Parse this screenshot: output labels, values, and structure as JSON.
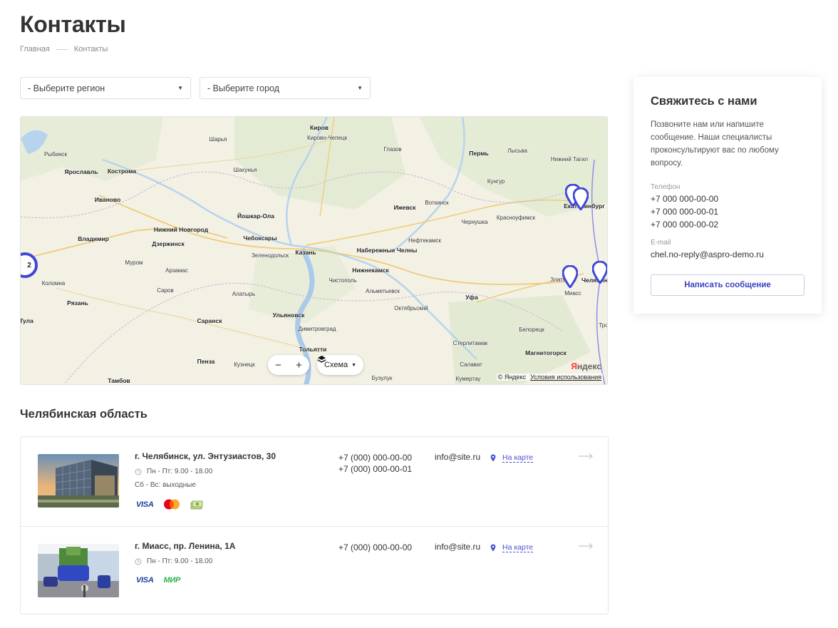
{
  "page": {
    "title": "Контакты"
  },
  "breadcrumb": {
    "home": "Главная",
    "current": "Контакты"
  },
  "filters": {
    "region_label": "- Выберите регион",
    "city_label": "- Выберите город"
  },
  "map": {
    "cities": [
      "Рыбинск",
      "Ярославль",
      "Кострома",
      "Шарья",
      "Киров",
      "Кирово-Чепецк",
      "Глазов",
      "Пермь",
      "Лысьва",
      "Нижний Тагил",
      "Шахунья",
      "Иваново",
      "Кунгур",
      "Екатеринбург",
      "Йошкар-Ола",
      "Ижевск",
      "Воткинск",
      "Красноуфимск",
      "Нижний Новгород",
      "Чебоксары",
      "Чернушка",
      "Владимир",
      "Дзержинск",
      "Нефтекамск",
      "Набережные Челны",
      "Зеленодольск",
      "Казань",
      "Муром",
      "Арзамас",
      "Нижнекамск",
      "Коломна",
      "Саров",
      "Чистополь",
      "Альметьевск",
      "Уфа",
      "Златоуст",
      "Миасс",
      "Челябинск",
      "Рязань",
      "Алатырь",
      "Октябрьский",
      "Ульяновск",
      "Тула",
      "Саранск",
      "Димитровград",
      "Белорецк",
      "Стерлитамак",
      "Тольятти",
      "Магнитогорск",
      "Пенза",
      "Кузнецк",
      "Салават",
      "Тамбов",
      "Бузулук",
      "Кумертау",
      "Тро"
    ],
    "cluster_count": "2",
    "zoom_minus": "−",
    "zoom_plus": "+",
    "layer_label": "Схема",
    "copyright": "© Яндекс",
    "terms": "Условия использования",
    "logo": "Яндекс"
  },
  "region": {
    "title": "Челябинская область"
  },
  "offices": [
    {
      "address": "г. Челябинск, ул. Энтузиастов, 30",
      "hours": "Пн - Пт: 9.00 - 18.00",
      "hours_extra": "Сб - Вс: выходные",
      "phones": [
        "+7 (000) 000-00-00",
        "+7 (000) 000-00-01"
      ],
      "email": "info@site.ru",
      "map_link": "На карте",
      "payments": [
        "VISA",
        "mastercard",
        "cash"
      ]
    },
    {
      "address": "г. Миасс, пр. Ленина, 1А",
      "hours": "Пн - Пт: 9.00 - 18.00",
      "phones": [
        "+7 (000) 000-00-00"
      ],
      "email": "info@site.ru",
      "map_link": "На карте",
      "payments": [
        "VISA",
        "МИР"
      ]
    }
  ],
  "contact_card": {
    "title": "Свяжитесь с нами",
    "description": "Позвоните нам или напишите сообщение. Наши специалисты проконсультируют вас по любому вопросу.",
    "phone_label": "Телефон",
    "phones": [
      "+7 000 000-00-00",
      "+7 000 000-00-01",
      "+7 000 000-00-02"
    ],
    "email_label": "E-mail",
    "email": "chel.no-reply@aspro-demo.ru",
    "button": "Написать сообщение"
  },
  "colors": {
    "accent": "#3b40c2",
    "pin": "#3f48d6",
    "visa": "#1a3f9e",
    "mir": "#2bb24c"
  }
}
